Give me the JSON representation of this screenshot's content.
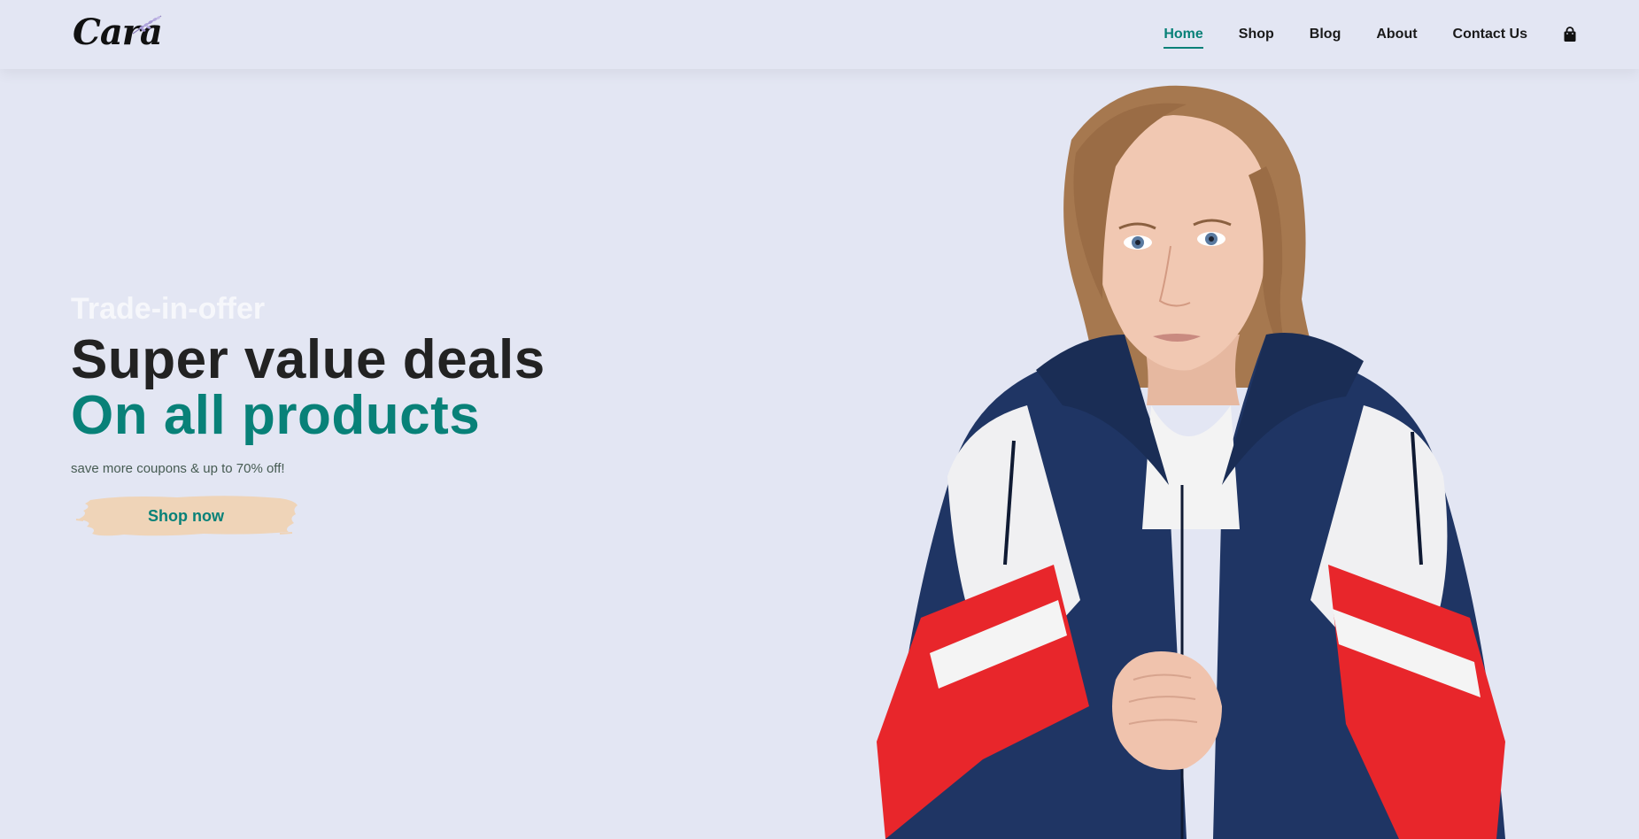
{
  "brand": {
    "logo_text": "Cara"
  },
  "nav": {
    "items": [
      {
        "label": "Home",
        "active": true
      },
      {
        "label": "Shop",
        "active": false
      },
      {
        "label": "Blog",
        "active": false
      },
      {
        "label": "About",
        "active": false
      },
      {
        "label": "Contact Us",
        "active": false
      }
    ],
    "cart_icon": "shopping-bag-icon"
  },
  "hero": {
    "kicker": "Trade-in-offer",
    "title": "Super value deals",
    "title_accent": "On all products",
    "subtitle": "save more coupons & up to 70% off!",
    "cta_label": "Shop now"
  },
  "colors": {
    "background": "#e3e6f3",
    "accent": "#088178",
    "button_brush": "#efd4b8"
  }
}
